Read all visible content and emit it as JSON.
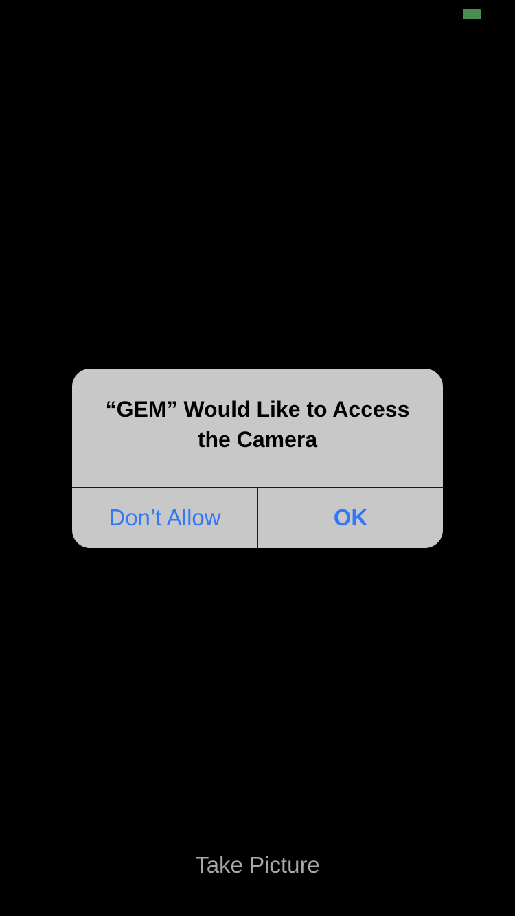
{
  "status_bar": {
    "battery_color": "#4a8d4e"
  },
  "alert": {
    "title_line1": "“GEM” Would Like to Access",
    "title_line2": "the Camera",
    "dont_allow_label": "Don’t Allow",
    "ok_label": "OK",
    "button_color": "#3478f6",
    "background_color": "#c8c8c8"
  },
  "camera": {
    "take_picture_label": "Take Picture"
  }
}
